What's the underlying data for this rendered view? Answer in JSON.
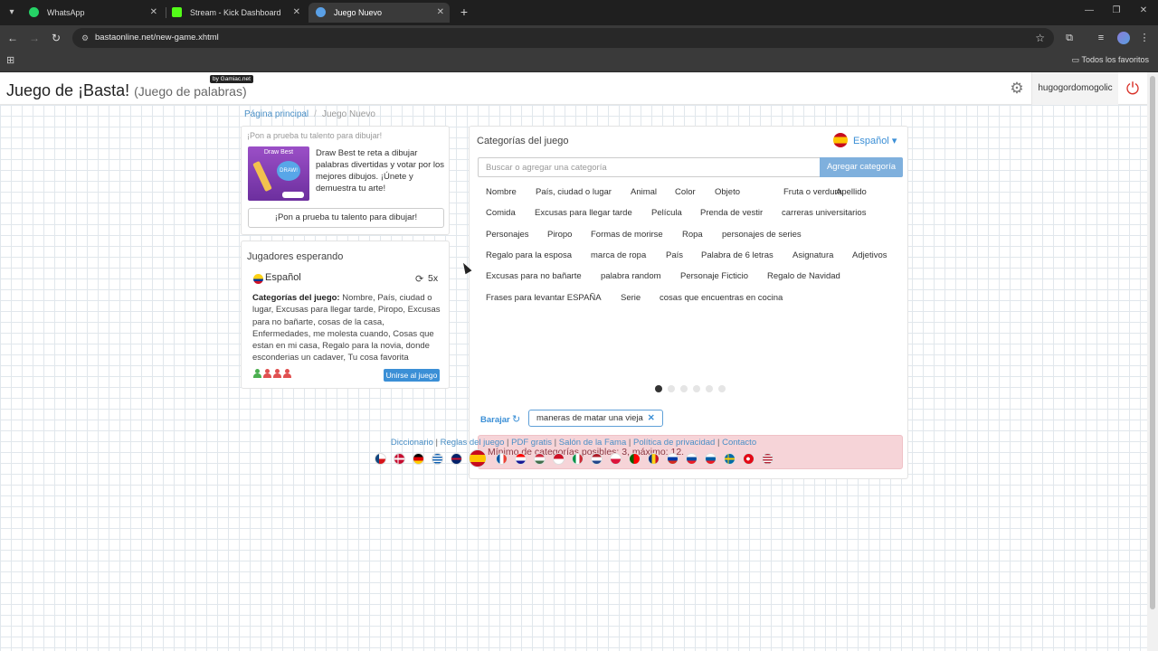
{
  "browser": {
    "tabs": [
      {
        "title": "WhatsApp",
        "color": "#25d366"
      },
      {
        "title": "Stream - Kick Dashboard",
        "color": "#53fc18"
      },
      {
        "title": "Juego Nuevo",
        "color": "#5aa0e6",
        "active": true
      }
    ],
    "url": "bastaonline.net/new-game.xhtml",
    "bookmarks_folder": "Todos los favoritos"
  },
  "header": {
    "title": "Juego de ¡Basta!",
    "subtitle": "(Juego de palabras)",
    "badge": "by Gamiac.net",
    "username": "hugogordomogolic"
  },
  "breadcrumb": {
    "home": "Página principal",
    "current": "Juego Nuevo"
  },
  "promo": {
    "heading": "¡Pon a prueba tu talento para dibujar!",
    "image_title": "Draw Best",
    "image_badge": "DRAW!",
    "text": "Draw Best te reta a dibujar palabras divertidas y votar por los mejores dibujos. ¡Únete y demuestra tu arte!",
    "button": "¡Pon a prueba tu talento para dibujar!"
  },
  "players": {
    "title": "Jugadores esperando",
    "language": "Español",
    "rounds": "5x",
    "categories_label": "Categorías del juego:",
    "categories_text": "Nombre, País, ciudad o lugar, Excusas para llegar tarde, Piropo, Excusas para no bañarte, cosas de la casa, Enfermedades, me molesta cuando, Cosas que estan en mi casa, Regalo para la novia, donde esconderias un cadaver, Tu cosa favorita",
    "player_colors": [
      "#4caf50",
      "#e05050",
      "#e05050",
      "#e05050"
    ],
    "join_button": "Unirse al juego"
  },
  "categories": {
    "title": "Categorías del juego",
    "language": "Español",
    "search_placeholder": "Buscar o agregar una categoría",
    "add_button": "Agregar categoría",
    "rows": [
      [
        "Nombre",
        "País, ciudad o lugar",
        "Animal",
        "Color",
        "Objeto",
        "Fruta o verdura",
        "Apellido"
      ],
      [
        "Comida",
        "Excusas para llegar tarde",
        "Película",
        "Prenda de vestir",
        "carreras universitarios"
      ],
      [
        "Personajes",
        "Piropo",
        "Formas de morirse",
        "Ropa",
        "personajes de series"
      ],
      [
        "Regalo para la esposa",
        "marca de ropa",
        "País",
        "Palabra de 6 letras",
        "Asignatura",
        "Adjetivos"
      ],
      [
        "Excusas para no bañarte",
        "palabra random",
        "Personaje Ficticio",
        "Regalo de Navidad"
      ],
      [
        "Frases para levantar ESPAÑA",
        "Serie",
        "cosas que encuentras en cocina"
      ]
    ],
    "page_dots": 6,
    "active_dot": 0,
    "shuffle_label": "Barajar",
    "selected": [
      "maneras de matar una vieja"
    ],
    "alert": "Mínimo de categorías posibles: 3, máximo: 12."
  },
  "footer": {
    "links": [
      "Diccionario",
      "Reglas del juego",
      "PDF gratis",
      "Salón de la Fama",
      "Política de privacidad",
      "Contacto"
    ]
  }
}
